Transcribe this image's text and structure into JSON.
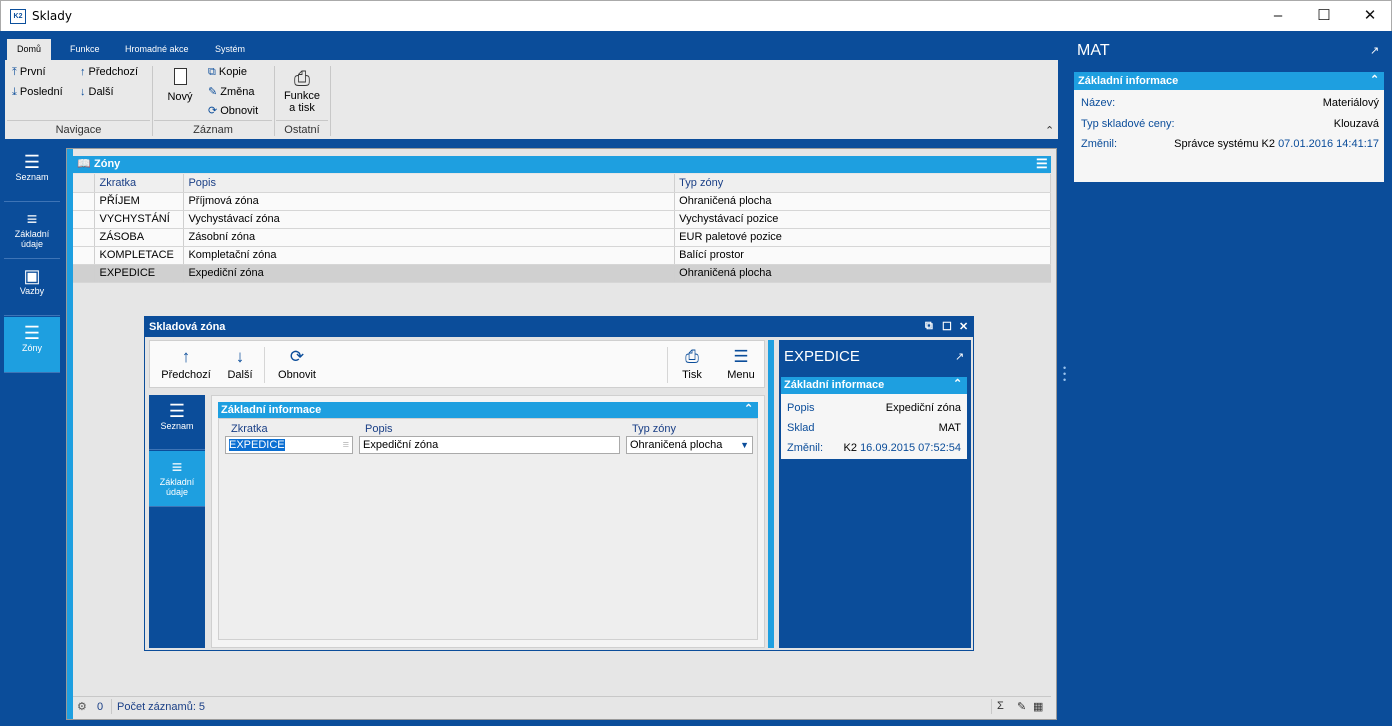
{
  "window": {
    "title": "Sklady",
    "app_icon_text": "K2"
  },
  "ribbon": {
    "tabs": [
      "Domů",
      "Funkce",
      "Hromadné akce",
      "Systém"
    ],
    "nav": {
      "first": "První",
      "last": "Poslední",
      "previous": "Předchozí",
      "next": "Další",
      "group_label": "Navigace"
    },
    "record": {
      "new": "Nový",
      "copy": "Kopie",
      "change": "Změna",
      "refresh": "Obnovit",
      "group_label": "Záznam"
    },
    "other": {
      "functions_line1": "Funkce",
      "functions_line2": "a tisk",
      "group_label": "Ostatní"
    }
  },
  "leftnav": {
    "items": [
      {
        "label": "Seznam",
        "icon": "list-icon"
      },
      {
        "label_line1": "Základní",
        "label_line2": "údaje",
        "icon": "details-icon"
      },
      {
        "label": "Vazby",
        "icon": "box-icon"
      },
      {
        "label": "Zóny",
        "icon": "list-icon"
      }
    ]
  },
  "main": {
    "title": "Zóny",
    "columns": [
      "Zkratka",
      "Popis",
      "Typ zóny"
    ],
    "rows": [
      {
        "zkratka": "PŘÍJEM",
        "popis": "Příjmová zóna",
        "typ": "Ohraničená plocha"
      },
      {
        "zkratka": "VYCHYSTÁNÍ",
        "popis": "Vychystávací zóna",
        "typ": "Vychystávací pozice"
      },
      {
        "zkratka": "ZÁSOBA",
        "popis": "Zásobní zóna",
        "typ": "EUR paletové pozice"
      },
      {
        "zkratka": "KOMPLETACE",
        "popis": "Kompletační zóna",
        "typ": "Balící prostor"
      },
      {
        "zkratka": "EXPEDICE",
        "popis": "Expediční zóna",
        "typ": "Ohraničená plocha"
      }
    ],
    "status": {
      "filter_count": "0",
      "record_count": "Počet záznamů: 5"
    }
  },
  "rightpanel": {
    "title": "MAT",
    "section": "Základní informace",
    "fields": [
      {
        "key": "Název:",
        "value": "Materiálový"
      },
      {
        "key": "Typ skladové ceny:",
        "value": "Klouzavá"
      }
    ],
    "changed_key": "Změnil:",
    "changed_user": "Správce systému K2",
    "changed_date": "07.01.2016 14:41:17"
  },
  "dialog": {
    "title": "Skladová zóna",
    "toolbar": {
      "previous": "Předchozí",
      "next": "Další",
      "refresh": "Obnovit",
      "print": "Tisk",
      "menu": "Menu"
    },
    "nav": {
      "list": "Seznam",
      "basic_line1": "Základní",
      "basic_line2": "údaje"
    },
    "section": "Základní informace",
    "fields": {
      "zkratka_label": "Zkratka",
      "zkratka_value": "EXPEDICE",
      "popis_label": "Popis",
      "popis_value": "Expediční zóna",
      "typ_label": "Typ zóny",
      "typ_value": "Ohraničená plocha"
    },
    "right": {
      "title": "EXPEDICE",
      "section": "Základní informace",
      "fields": [
        {
          "key": "Popis",
          "value": "Expediční zóna"
        },
        {
          "key": "Sklad",
          "value": "MAT"
        }
      ],
      "changed_key": "Změnil:",
      "changed_user": "K2",
      "changed_date": "16.09.2015 07:52:54"
    }
  }
}
